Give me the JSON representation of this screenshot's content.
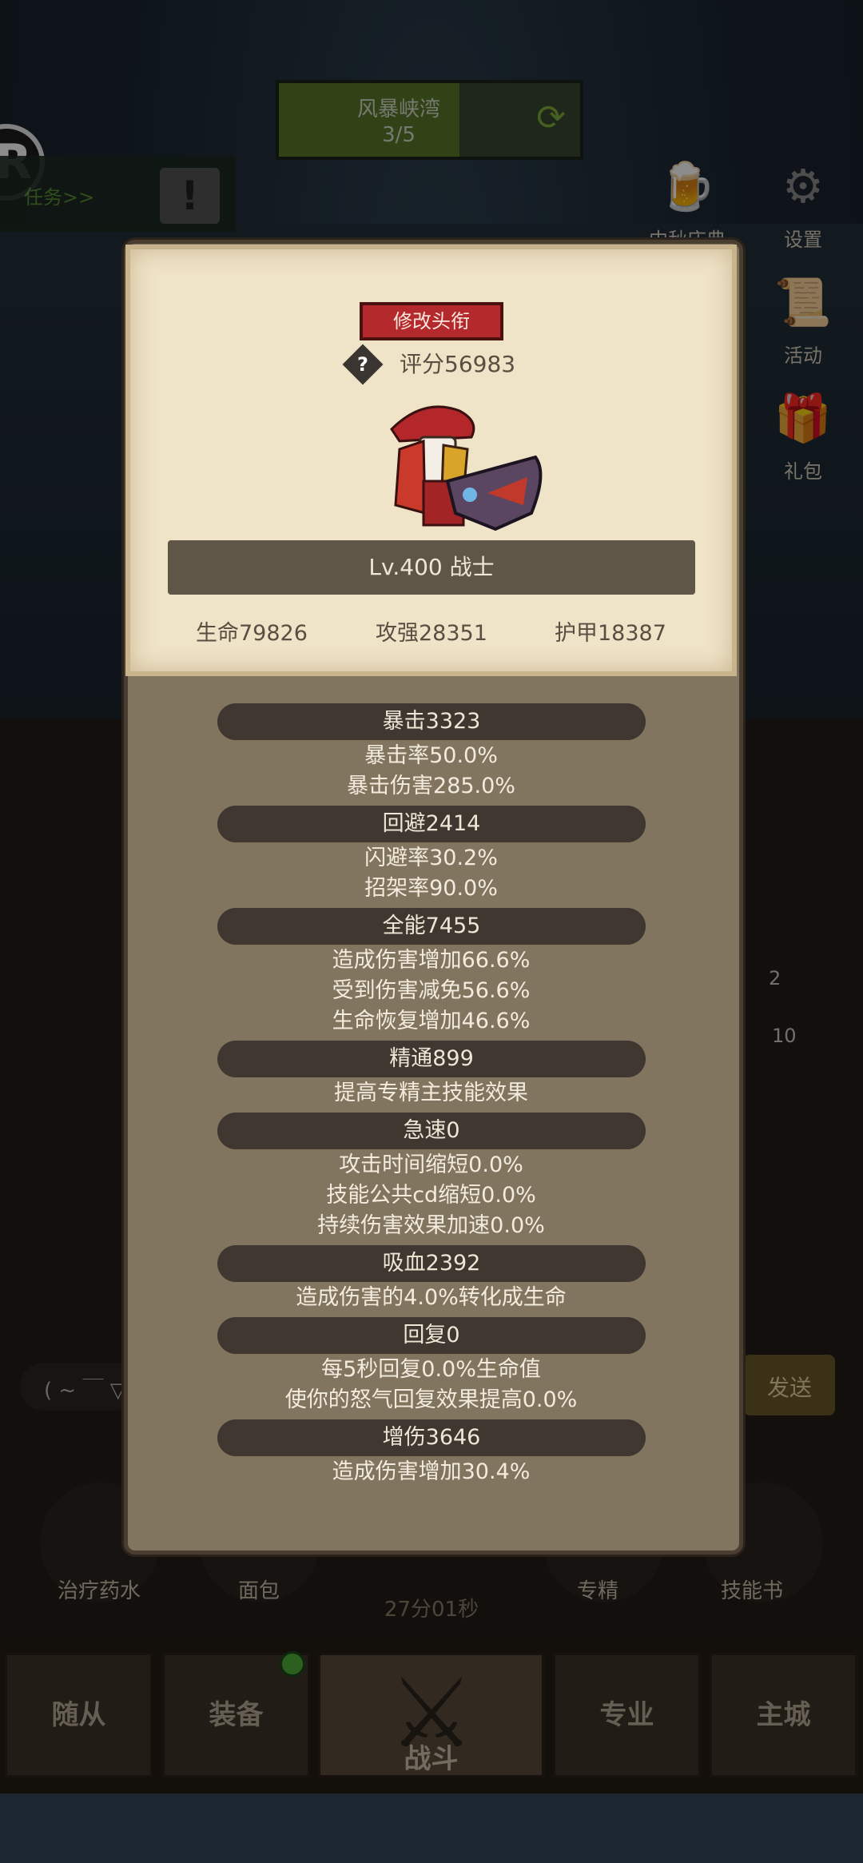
{
  "stage": {
    "name": "风暴峡湾",
    "progress": "3/5",
    "progress_ratio": 0.6
  },
  "quest": {
    "label": "任务>>"
  },
  "side_buttons": [
    {
      "label": "中秋庆典",
      "icon": "beer-mug-icon"
    },
    {
      "label": "设置",
      "icon": "gear-icon"
    },
    {
      "label": "活动",
      "icon": "scroll-icon"
    },
    {
      "label": "礼包",
      "icon": "gift-icon"
    }
  ],
  "bg_input_hint": "( ~ ￣ ▽",
  "bg_send": "发送",
  "quick_items": [
    {
      "label": "治疗药水"
    },
    {
      "label": "面包"
    },
    {
      "label": "专精"
    },
    {
      "label": "技能书"
    }
  ],
  "bg_badges": [
    "2",
    "10"
  ],
  "timer": "27分01秒",
  "bottom_nav": [
    {
      "label": "随从"
    },
    {
      "label": "装备"
    },
    {
      "label": "战斗"
    },
    {
      "label": "专业"
    },
    {
      "label": "主城"
    }
  ],
  "profile": {
    "title_button": "修改头衔",
    "score": "评分56983",
    "level_class": "Lv.400 战士",
    "hp": "生命79826",
    "attack": "攻强28351",
    "armor": "护甲18387"
  },
  "stats": [
    {
      "header": "暴击3323",
      "lines": [
        "暴击率50.0%",
        "暴击伤害285.0%"
      ]
    },
    {
      "header": "回避2414",
      "lines": [
        "闪避率30.2%",
        "招架率90.0%"
      ]
    },
    {
      "header": "全能7455",
      "lines": [
        "造成伤害增加66.6%",
        "受到伤害减免56.6%",
        "生命恢复增加46.6%"
      ]
    },
    {
      "header": "精通899",
      "lines": [
        "提高专精主技能效果"
      ]
    },
    {
      "header": "急速0",
      "lines": [
        "攻击时间缩短0.0%",
        "技能公共cd缩短0.0%",
        "持续伤害效果加速0.0%"
      ]
    },
    {
      "header": "吸血2392",
      "lines": [
        "造成伤害的4.0%转化成生命"
      ]
    },
    {
      "header": "回复0",
      "lines": [
        "每5秒回复0.0%生命值",
        "使你的怒气回复效果提高0.0%"
      ]
    },
    {
      "header": "增伤3646",
      "lines": [
        "造成伤害增加30.4%"
      ]
    }
  ]
}
